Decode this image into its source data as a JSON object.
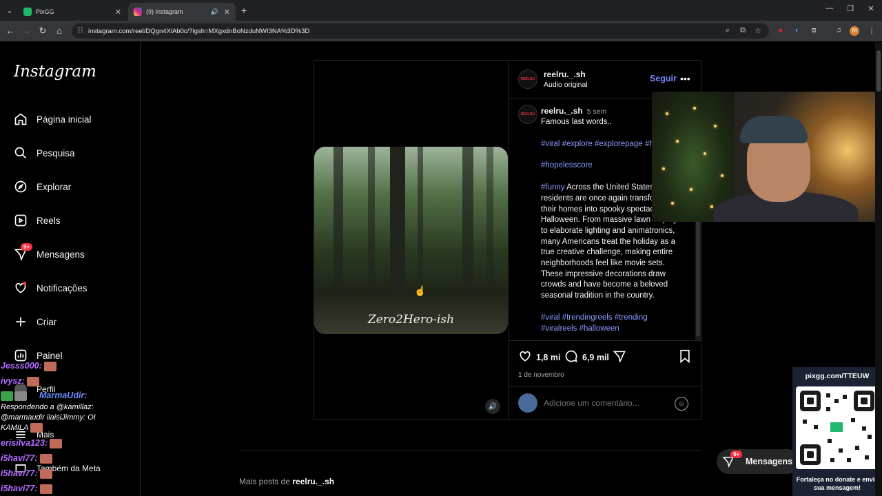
{
  "browser": {
    "tabs": [
      {
        "title": "PixGG",
        "favicon_color": "#1fb86b"
      },
      {
        "title": "(9) Instagram",
        "favicon_color": "#d62976"
      }
    ],
    "url": "instagram.com/reel/DQgn4XlAb0c/?igsh=MXgxdnBoNzduNWI3NA%3D%3D"
  },
  "sidebar": {
    "logo": "Instagram",
    "items": [
      {
        "label": "Página inicial",
        "icon": "home-icon"
      },
      {
        "label": "Pesquisa",
        "icon": "search-icon"
      },
      {
        "label": "Explorar",
        "icon": "compass-icon"
      },
      {
        "label": "Reels",
        "icon": "reels-icon"
      },
      {
        "label": "Mensagens",
        "icon": "messenger-icon"
      },
      {
        "label": "Notificações",
        "icon": "heart-icon"
      },
      {
        "label": "Criar",
        "icon": "plus-icon"
      },
      {
        "label": "Painel",
        "icon": "chart-icon"
      },
      {
        "label": "Perfil",
        "icon": "avatar-icon"
      },
      {
        "label": "Mais",
        "icon": "menu-icon"
      },
      {
        "label": "Também da Meta",
        "icon": "meta-icon"
      }
    ],
    "messages_badge": "9+"
  },
  "post": {
    "overlay_text": "Zero2Hero-ish",
    "username": "reelru._.sh",
    "audio": "Áudio original",
    "follow_label": "Seguir",
    "caption_time": "5 sem",
    "caption_first": "Famous last words..",
    "tags_1": "#viral #explore #explorepage #hopecore",
    "tags_2": "#hopelesscore",
    "tag_funny": "#funny",
    "caption_body": "Across the United States, residents are once again transforming their homes into spooky spectacles for Halloween. From massive lawn displays to elaborate lighting and animatronics, many Americans treat the holiday as a true creative challenge, making entire neighborhoods feel like movie sets. These impressive decorations draw crowds and have become a beloved seasonal tradition in the country.",
    "tags_3": "#viral #trendingreels #trending #viralreels #halloween",
    "likes": "1,8 mi",
    "comments": "6,9 mil",
    "date": "1 de novembro",
    "comment_placeholder": "Adicione um comentário..."
  },
  "more_posts": {
    "prefix": "Mais posts de",
    "username": "reelru._.sh"
  },
  "floating_messages": {
    "label": "Mensagens",
    "badge": "9+"
  },
  "overlay": {
    "qr_url": "pixgg.com/TTEUW",
    "qr_message": "Fortaleça no donate e envie sua mensagem!"
  },
  "chat": [
    {
      "user": "Jesss000:",
      "text": ""
    },
    {
      "user": "ivysz:",
      "text": ""
    },
    {
      "user": "MarmaUdir:",
      "text": ""
    },
    {
      "user": "",
      "text": "Respondendo a @kamillaz:"
    },
    {
      "user": "",
      "text": "@marmaudir ilaisiJimmy: OI"
    },
    {
      "user": "",
      "text": "KAMILA"
    },
    {
      "user": "erisilva123:",
      "text": ""
    },
    {
      "user": "i5havi77:",
      "text": ""
    },
    {
      "user": "i5havi77:",
      "text": ""
    },
    {
      "user": "i5havi77:",
      "text": ""
    }
  ]
}
